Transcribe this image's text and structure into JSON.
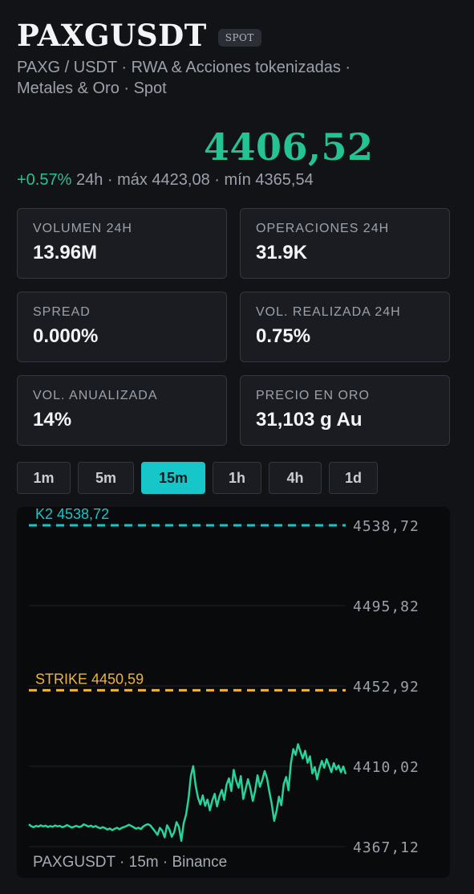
{
  "header": {
    "title": "PAXGUSDT",
    "badge": "SPOT",
    "subtitle": "PAXG / USDT · RWA & Acciones tokenizadas · Metales & Oro · Spot"
  },
  "price": "4406,52",
  "stats": {
    "change": "+0.57%",
    "rest": " 24h · máx 4423,08 · mín 4365,54"
  },
  "cards": [
    {
      "label": "VOLUMEN 24H",
      "value": "13.96M"
    },
    {
      "label": "OPERACIONES 24H",
      "value": "31.9K"
    },
    {
      "label": "SPREAD",
      "value": "0.000%"
    },
    {
      "label": "VOL. REALIZADA 24H",
      "value": "0.75%"
    },
    {
      "label": "VOL. ANUALIZADA",
      "value": "14%"
    },
    {
      "label": "PRECIO EN ORO",
      "value": "31,103 g Au"
    }
  ],
  "timeframes": [
    "1m",
    "5m",
    "15m",
    "1h",
    "4h",
    "1d"
  ],
  "active_timeframe": "15m",
  "chart_data": {
    "type": "line",
    "footer": "PAXGUSDT · 15m · Binance",
    "y_ticks": [
      "4538,72",
      "4495,82",
      "4452,92",
      "4410,02",
      "4367,12"
    ],
    "ylim": [
      4367.12,
      4538.72
    ],
    "reference_lines": [
      {
        "label": "K2 4538,72",
        "value": 4538.72,
        "color": "#16c6c9"
      },
      {
        "label": "STRIKE 4450,59",
        "value": 4450.59,
        "color": "#f0b43a"
      }
    ],
    "line_color": "#27d39a",
    "values": [
      4379,
      4378,
      4377.5,
      4378.2,
      4377.8,
      4378.5,
      4377.9,
      4378.3,
      4377.6,
      4378.1,
      4377.7,
      4378.4,
      4377.9,
      4378.2,
      4377.5,
      4377.9,
      4378.6,
      4378,
      4377.3,
      4377.8,
      4378.2,
      4377.6,
      4377.9,
      4379,
      4378.5,
      4377.8,
      4378.3,
      4377.6,
      4378.1,
      4377.4,
      4376.9,
      4377.5,
      4377,
      4376.2,
      4376.8,
      4375.9,
      4376.6,
      4377.2,
      4376.4,
      4377.1,
      4377.6,
      4378.1,
      4378.8,
      4378.2,
      4377.4,
      4376.7,
      4377.2,
      4376.5,
      4377.9,
      4378.6,
      4379.1,
      4378.4,
      4376.8,
      4375.2,
      4373.4,
      4377.1,
      4375.6,
      4372.1,
      4378.5,
      4376.3,
      4372.4,
      4374.9,
      4380.2,
      4377.6,
      4370.2,
      4379.6,
      4384.2,
      4392.6,
      4404.9,
      4410.1,
      4399.8,
      4393.2,
      4389.7,
      4394.5,
      4388.9,
      4392.2,
      4386.5,
      4391.8,
      4395.3,
      4388.6,
      4393.9,
      4397.4,
      4392.1,
      4400.2,
      4403.6,
      4396.8,
      4408.1,
      4402.4,
      4398.6,
      4404.8,
      4392.6,
      4397.9,
      4403.1,
      4398.4,
      4391.5,
      4396.9,
      4405.2,
      4399.1,
      4402.8,
      4407.5,
      4403.4,
      4396.1,
      4389.7,
      4380.9,
      4386.4,
      4393.8,
      4389.2,
      4400.6,
      4404.3,
      4397.2,
      4411.6,
      4419.2,
      4416.1,
      4421.8,
      4417.9,
      4414.2,
      4418.3,
      4411.9,
      4415.4,
      4406.2,
      4409.6,
      4403.1,
      4408.7,
      4412.9,
      4409.2,
      4413.8,
      4410.5,
      4406.9,
      4411.7,
      4408.3,
      4410.4,
      4406.8,
      4409.9,
      4405.8
    ]
  }
}
